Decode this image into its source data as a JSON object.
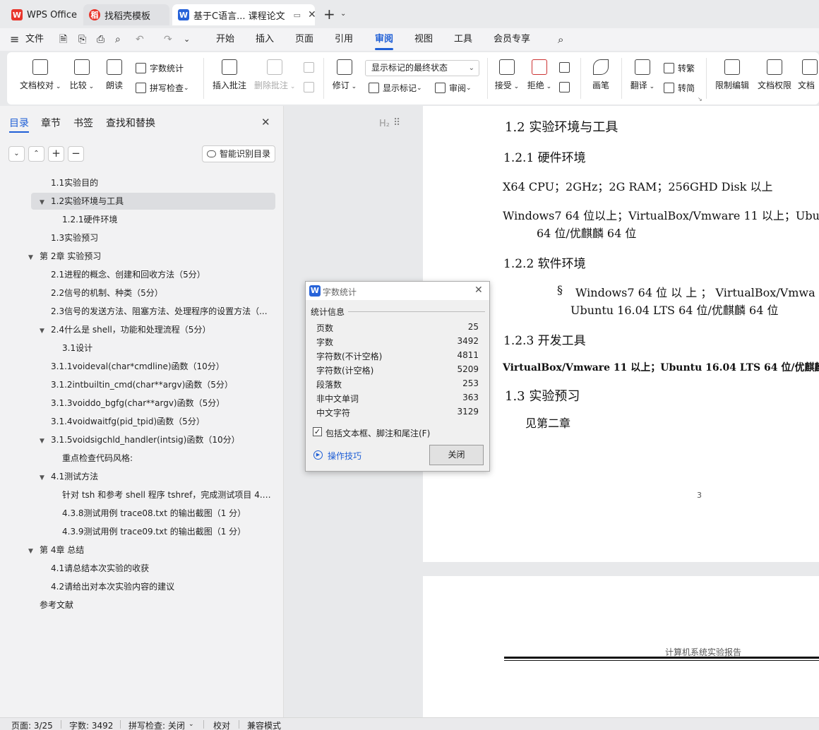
{
  "tabs": [
    {
      "label": "WPS Office",
      "icon": "wps-logo-icon"
    },
    {
      "label": "找稻壳模板",
      "icon": "docer-icon"
    },
    {
      "label": "基于C语言... 课程论文",
      "icon": "writer-doc-icon",
      "active": true
    }
  ],
  "menu": {
    "file": "文件",
    "items": [
      "开始",
      "插入",
      "页面",
      "引用",
      "审阅",
      "视图",
      "工具",
      "会员专享"
    ],
    "active": "审阅"
  },
  "ribbon": {
    "doc_check": "文档校对",
    "compare": "比较",
    "read_aloud": "朗读",
    "word_count": "字数统计",
    "spell_check": "拼写检查",
    "insert_comment": "插入批注",
    "delete_comment": "删除批注",
    "revise": "修订",
    "markup_select": "显示标记的最终状态",
    "show_markup": "显示标记",
    "review_pane": "审阅",
    "accept": "接受",
    "reject": "拒绝",
    "pen": "画笔",
    "translate": "翻译",
    "to_traditional": "转繁",
    "to_simplified": "转简",
    "restrict_edit": "限制编辑",
    "doc_permission": "文档权限",
    "doc_more": "文档"
  },
  "panel": {
    "tabs": [
      "目录",
      "章节",
      "书签",
      "查找和替换"
    ],
    "active_tab": "目录",
    "smart_toc": "智能识别目录",
    "toc": [
      {
        "text": "1.1实验目的",
        "level": 2,
        "arrow": ""
      },
      {
        "text": "1.2实验环境与工具",
        "level": 2,
        "arrow": "▼",
        "selected": true
      },
      {
        "text": "1.2.1硬件环境",
        "level": 3,
        "arrow": ""
      },
      {
        "text": "1.3实验预习",
        "level": 2,
        "arrow": ""
      },
      {
        "text": "第 2章 实验预习",
        "level": 1,
        "arrow": "▼"
      },
      {
        "text": "2.1进程的概念、创建和回收方法（5分）",
        "level": 2,
        "arrow": ""
      },
      {
        "text": "2.2信号的机制、种类（5分）",
        "level": 2,
        "arrow": ""
      },
      {
        "text": "2.3信号的发送方法、阻塞方法、处理程序的设置方法（...",
        "level": 2,
        "arrow": ""
      },
      {
        "text": "2.4什么是 shell，功能和处理流程（5分）",
        "level": 2,
        "arrow": "▼"
      },
      {
        "text": "3.1设计",
        "level": 3,
        "arrow": ""
      },
      {
        "text": "3.1.1voideval(char*cmdline)函数（10分）",
        "level": 2,
        "arrow": ""
      },
      {
        "text": "3.1.2intbuiltin_cmd(char**argv)函数（5分）",
        "level": 2,
        "arrow": ""
      },
      {
        "text": "3.1.3voiddo_bgfg(char**argv)函数（5分）",
        "level": 2,
        "arrow": ""
      },
      {
        "text": "3.1.4voidwaitfg(pid_tpid)函数（5分）",
        "level": 2,
        "arrow": ""
      },
      {
        "text": "3.1.5voidsigchld_handler(intsig)函数（10分）",
        "level": 2,
        "arrow": "▼"
      },
      {
        "text": "重点检查代码风格:",
        "level": 3,
        "arrow": ""
      },
      {
        "text": "4.1测试方法",
        "level": 2,
        "arrow": "▼"
      },
      {
        "text": "针对 tsh 和参考 shell 程序 tshref，完成测试项目 4.1 ...",
        "level": 3,
        "arrow": ""
      },
      {
        "text": "4.3.8测试用例 trace08.txt 的输出截图（1 分）",
        "level": 3,
        "arrow": ""
      },
      {
        "text": "4.3.9测试用例 trace09.txt 的输出截图（1 分）",
        "level": 3,
        "arrow": ""
      },
      {
        "text": "第 4章 总结",
        "level": 1,
        "arrow": "▼"
      },
      {
        "text": "4.1请总结本次实验的收获",
        "level": 2,
        "arrow": ""
      },
      {
        "text": "4.2请给出对本次实验内容的建议",
        "level": 2,
        "arrow": ""
      },
      {
        "text": "参考文献",
        "level": 1,
        "arrow": ""
      }
    ]
  },
  "gutter": {
    "heading_marker": "H₂"
  },
  "document": {
    "h_12": "1.2 实验环境与工具",
    "h_121": "1.2.1 硬件环境",
    "hw_line": "X64 CPU；2GHz；2G RAM；256GHD Disk 以上",
    "sw_line1": "Windows7 64 位以上；VirtualBox/Vmware 11 以上；Ubu",
    "sw_line1b": "64 位/优麒麟 64 位",
    "h_122": "1.2.2 软件环境",
    "bullet": "§",
    "bullet_l1": "Windows7  64  位 以 上 ；  VirtualBox/Vmwa",
    "bullet_l2": "Ubuntu 16.04 LTS 64 位/优麒麟 64 位",
    "h_123": "1.2.3 开发工具",
    "dev_line": "VirtualBox/Vmware 11 以上；Ubuntu 16.04 LTS 64 位/优麒麟 64",
    "h_13": "1.3 实验预习",
    "see_ch2": "见第二章",
    "page_number": "3",
    "header_next": "计算机系统实验报告"
  },
  "dialog": {
    "title": "字数统计",
    "section": "统计信息",
    "stats": [
      {
        "label": "页数",
        "value": "25"
      },
      {
        "label": "字数",
        "value": "3492"
      },
      {
        "label": "字符数(不计空格)",
        "value": "4811"
      },
      {
        "label": "字符数(计空格)",
        "value": "5209"
      },
      {
        "label": "段落数",
        "value": "253"
      },
      {
        "label": "非中文单词",
        "value": "363"
      },
      {
        "label": "中文字符",
        "value": "3129"
      }
    ],
    "include_label": "包括文本框、脚注和尾注(F)",
    "include_checked": true,
    "tips": "操作技巧",
    "close": "关闭"
  },
  "status": {
    "page": "页面: 3/25",
    "words": "字数: 3492",
    "spell": "拼写检查: 关闭",
    "proof": "校对",
    "compat": "兼容模式"
  },
  "colors": {
    "accent": "#1f5fd6",
    "wps_red": "#e8352b",
    "doc_blue": "#2763d9"
  }
}
